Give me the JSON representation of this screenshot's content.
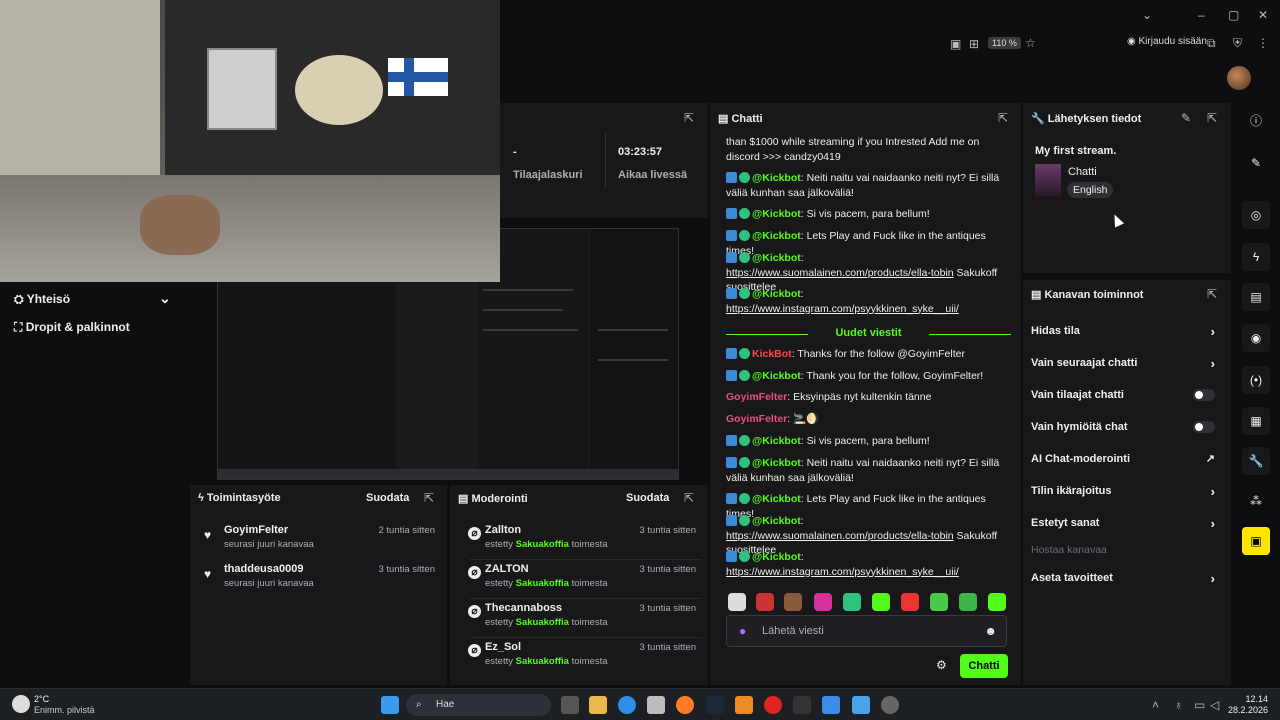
{
  "browser": {
    "zoom": "110 %",
    "login_label": "Kirjaudu sisään"
  },
  "stats": {
    "value1": "-",
    "label1": "Tilaajalaskuri",
    "value2": "03:23:57",
    "label2": "Aikaa livessä"
  },
  "sidebar": {
    "items": [
      {
        "label": "Yhteisö",
        "icon": "people-icon"
      },
      {
        "label": "Dropit & palkinnot",
        "icon": "gift-icon"
      }
    ]
  },
  "chat": {
    "title": "Chatti",
    "new_messages_label": "Uudet viestit",
    "input_placeholder": "Lähetä viesti",
    "send_label": "Chatti",
    "messages_before": [
      {
        "user": "",
        "text": "than $1000 while streaming if you Intrested Add me on discord >>> candzy0419"
      },
      {
        "user": "@Kickbot",
        "text": ": Neiti naitu vai naidaanko neiti nyt? Ei sillä väliä kunhan saa jälkoväliä!"
      },
      {
        "user": "@Kickbot",
        "text": ": Si vis pacem, para bellum!"
      },
      {
        "user": "@Kickbot",
        "text": ": Lets Play and Fuck like in the antiques times!"
      },
      {
        "user": "@Kickbot",
        "link": "https://www.suomalainen.com/products/ella-tobin",
        "text": " Sakukoff suosittelee"
      },
      {
        "user": "@Kickbot",
        "link": "https://www.instagram.com/psyykkinen_syke__uii/",
        "text": ""
      }
    ],
    "messages_after": [
      {
        "user": "KickBot",
        "text": ": Thanks for the follow @GoyimFelter"
      },
      {
        "user": "@Kickbot",
        "text": ": Thank you for the follow, GoyimFelter!"
      },
      {
        "user": "GoyimFelter",
        "text": ": Eksyinpäs nyt kultenkin tänne"
      },
      {
        "user": "GoyimFelter",
        "text": ": 🚬🌖"
      },
      {
        "user": "@Kickbot",
        "text": ": Si vis pacem, para bellum!"
      },
      {
        "user": "@Kickbot",
        "text": ": Neiti naitu vai naidaanko neiti nyt? Ei sillä väliä kunhan saa jälkoväliä!"
      },
      {
        "user": "@Kickbot",
        "text": ": Lets Play and Fuck like in the antiques times!"
      },
      {
        "user": "@Kickbot",
        "link": "https://www.suomalainen.com/products/ella-tobin",
        "text": " Sakukoff suosittelee"
      },
      {
        "user": "@Kickbot",
        "link": "https://www.instagram.com/psyykkinen_syke__uii/",
        "text": ""
      }
    ]
  },
  "info": {
    "title": "Lähetyksen tiedot",
    "stream_title": "My first stream.",
    "category": "Chatti",
    "language": "English"
  },
  "controls": {
    "title": "Kanavan toiminnot",
    "rows": [
      {
        "label": "Hidas tila",
        "kind": "chevron"
      },
      {
        "label": "Vain seuraajat chatti",
        "kind": "chevron"
      },
      {
        "label": "Vain tilaajat chatti",
        "kind": "toggle"
      },
      {
        "label": "Vain hymiöitä chat",
        "kind": "toggle"
      },
      {
        "label": "AI Chat-moderointi",
        "kind": "external"
      },
      {
        "label": "Tilin ikärajoitus",
        "kind": "chevron"
      },
      {
        "label": "Estetyt sanat",
        "kind": "chevron"
      },
      {
        "label": "Hostaa kanavaa",
        "kind": "disabled"
      },
      {
        "label": "Aseta tavoitteet",
        "kind": "chevron"
      }
    ]
  },
  "activity": {
    "title": "Toimintasyöte",
    "filter": "Suodata",
    "items": [
      {
        "name": "GoyimFelter",
        "sub": "seurasi juuri kanavaa",
        "time": "2 tuntia sitten"
      },
      {
        "name": "thaddeusa0009",
        "sub": "seurasi juuri kanavaa",
        "time": "3 tuntia sitten"
      }
    ]
  },
  "moderation": {
    "title": "Moderointi",
    "filter": "Suodata",
    "prefix": "estetty",
    "suffix": "toimesta",
    "by": "Sakuakoffia",
    "items": [
      {
        "name": "Zallton",
        "time": "3 tuntia sitten"
      },
      {
        "name": "ZALTON",
        "time": "3 tuntia sitten"
      },
      {
        "name": "Thecannaboss",
        "time": "3 tuntia sitten"
      },
      {
        "name": "Ez_Sol",
        "time": "3 tuntia sitten"
      }
    ]
  },
  "taskbar": {
    "weather_temp": "2°C",
    "weather_desc": "Enimm. pilvistä",
    "search": "Hae",
    "time": "12.14",
    "date": "28.2.2026"
  }
}
